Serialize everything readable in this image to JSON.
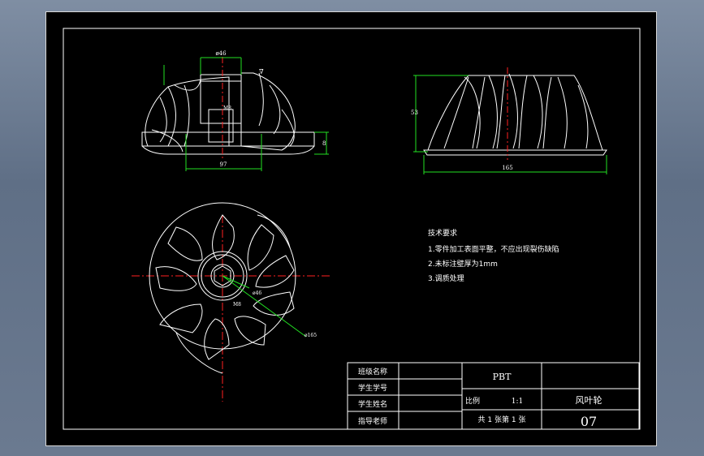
{
  "views": {
    "front": {
      "dim_top": "ø46",
      "dim_bottom": "97",
      "dim_height": "8",
      "dim_bore": "M8",
      "roughness": "∇"
    },
    "side": {
      "dim_height": "53",
      "dim_width": "165"
    },
    "top": {
      "dim_hub": "ø46",
      "dim_outer": "ø165",
      "dim_center": "M8"
    }
  },
  "notes": {
    "heading": "技术要求",
    "items": [
      "1.零件加工表面平整，不应出现裂伤缺陷",
      "2.未标注壁厚为1mm",
      "3.调质处理"
    ]
  },
  "title_block": {
    "row_labels": [
      "班级名称",
      "学生学号",
      "学生姓名",
      "指导老师"
    ],
    "material": "PBT",
    "scale_label": "比例",
    "scale_value": "1:1",
    "sheet_text": "共 1 张第 1 张",
    "part_name": "风叶轮",
    "drawing_no": "07"
  },
  "colors": {
    "background": "#000000",
    "lines": "#ffffff",
    "dimensions": "#22e022",
    "centerline": "#ff2020",
    "dim_text": "#ffff00"
  }
}
